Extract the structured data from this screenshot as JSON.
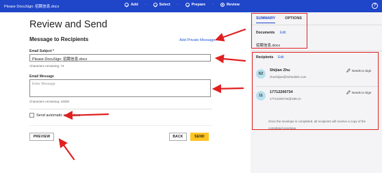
{
  "topbar": {
    "doc_title": "Please DocuSign: 招聘信息.docx",
    "steps": [
      {
        "label": "Add",
        "state": "done"
      },
      {
        "label": "Select",
        "state": "done"
      },
      {
        "label": "Prepare",
        "state": "done"
      },
      {
        "label": "Review",
        "state": "current"
      }
    ],
    "help": "?"
  },
  "main": {
    "title": "Review and Send",
    "section_title": "Message to Recipients",
    "private_link": "Add Private Message",
    "subject_label": "Email Subject *",
    "subject_value": "Please DocuSign: 招聘信息.docx",
    "chars_remaining_subject": "Characters remaining: 74",
    "message_label": "Email Message",
    "message_placeholder": "Enter Message",
    "chars_remaining_message": "Characters remaining: 10000",
    "reminder_label": "Send automatic reminders",
    "preview_label": "PREVIEW",
    "back_label": "BACK",
    "send_label": "SEND"
  },
  "side": {
    "tabs": [
      "SUMMARY",
      "OPTIONS"
    ],
    "documents_label": "Documents",
    "edit_label": "Edit",
    "document_name": "招聘信息.docx",
    "recipients_label": "Recipients",
    "recipients": [
      {
        "initials": "SZ",
        "name": "Shijian Zhu",
        "email": "zhushijian@mihealink.com",
        "role": "Needs to Sign"
      },
      {
        "initials": "11",
        "name": "17712200734",
        "email": "17712200734@189.cn",
        "role": "Needs to Sign"
      }
    ],
    "note": "Once the envelope is completed, all recipients will receive a copy of the completed envelope."
  },
  "colors": {
    "topbar": "#1f45c8",
    "send_button": "#ffc420",
    "annotation": "#e02020",
    "avatar": "#b9e1ef"
  }
}
